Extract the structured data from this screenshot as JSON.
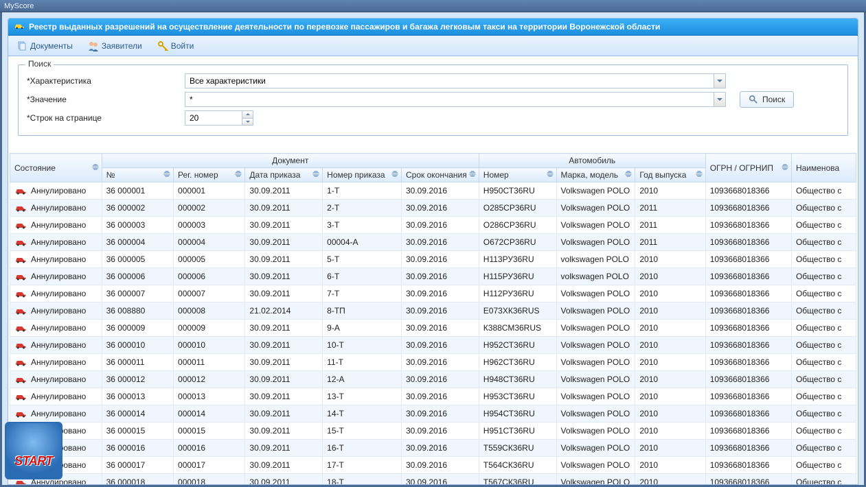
{
  "window": {
    "title": "MyScore"
  },
  "panel": {
    "title": "Реестр выданных разрешений на осуществление деятельности по перевозке пассажиров и багажа легковым такси на территории Воронежской области"
  },
  "toolbar": {
    "documents": "Документы",
    "applicants": "Заявители",
    "login": "Войти"
  },
  "search": {
    "legend": "Поиск",
    "char_label": "*Характеристика",
    "char_value": "Все характеристики",
    "val_label": "*Значение",
    "val_value": "*",
    "rows_label": "*Строк на странице",
    "rows_value": "20",
    "button": "Поиск"
  },
  "grid": {
    "group_doc": "Документ",
    "group_car": "Автомобиль",
    "headers": {
      "status": "Состояние",
      "num": "№",
      "regnum": "Рег. номер",
      "orddate": "Дата приказа",
      "ordnum": "Номер приказа",
      "expiry": "Срок окончания",
      "carnum": "Номер",
      "model": "Марка, модель",
      "year": "Год выпуска",
      "ogrn": "ОГРН / ОГРНИП",
      "company": "Наименова"
    },
    "status_label": "Аннулировано",
    "company_snip": "Общество с",
    "rows": [
      {
        "num": "36 000001",
        "regnum": "000001",
        "orddate": "30.09.2011",
        "ordnum": "1-Т",
        "expiry": "30.09.2016",
        "carnum": "Н950СТ36RU",
        "model": "Volkswagen POLO",
        "year": "2010",
        "ogrn": "1093668018366"
      },
      {
        "num": "36 000002",
        "regnum": "000002",
        "orddate": "30.09.2011",
        "ordnum": "2-Т",
        "expiry": "30.09.2016",
        "carnum": "О285СР36RU",
        "model": "Volkswagen POLO",
        "year": "2011",
        "ogrn": "1093668018366"
      },
      {
        "num": "36 000003",
        "regnum": "000003",
        "orddate": "30.09.2011",
        "ordnum": "3-Т",
        "expiry": "30.09.2016",
        "carnum": "О286СР36RU",
        "model": "Volkswagen POLO",
        "year": "2011",
        "ogrn": "1093668018366"
      },
      {
        "num": "36 000004",
        "regnum": "000004",
        "orddate": "30.09.2011",
        "ordnum": "00004-А",
        "expiry": "30.09.2016",
        "carnum": "О672СР36RU",
        "model": "Volkswagen POLO",
        "year": "2011",
        "ogrn": "1093668018366"
      },
      {
        "num": "36 000005",
        "regnum": "000005",
        "orddate": "30.09.2011",
        "ordnum": "5-Т",
        "expiry": "30.09.2016",
        "carnum": "Н113РУ36RU",
        "model": "volkswagen POLO",
        "year": "2010",
        "ogrn": "1093668018366"
      },
      {
        "num": "36 000006",
        "regnum": "000006",
        "orddate": "30.09.2011",
        "ordnum": "6-Т",
        "expiry": "30.09.2016",
        "carnum": "Н115РУ36RU",
        "model": "volkswagen POLO",
        "year": "2010",
        "ogrn": "1093668018366"
      },
      {
        "num": "36 000007",
        "regnum": "000007",
        "orddate": "30.09.2011",
        "ordnum": "7-Т",
        "expiry": "30.09.2016",
        "carnum": "Н112РУ36RU",
        "model": "Volkswagen POLO",
        "year": "2010",
        "ogrn": "1093668018366"
      },
      {
        "num": "36 008880",
        "regnum": "000008",
        "orddate": "21.02.2014",
        "ordnum": "8-ТП",
        "expiry": "30.09.2016",
        "carnum": "Е073ХК36RUS",
        "model": "Volkswagen POLO",
        "year": "2010",
        "ogrn": "1093668018366"
      },
      {
        "num": "36 000009",
        "regnum": "000009",
        "orddate": "30.09.2011",
        "ordnum": "9-А",
        "expiry": "30.09.2016",
        "carnum": "К388СМ36RUS",
        "model": "Volkswagen POLO",
        "year": "2010",
        "ogrn": "1093668018366"
      },
      {
        "num": "36 000010",
        "regnum": "000010",
        "orddate": "30.09.2011",
        "ordnum": "10-Т",
        "expiry": "30.09.2016",
        "carnum": "Н952СТ36RU",
        "model": "Volkswagen POLO",
        "year": "2010",
        "ogrn": "1093668018366"
      },
      {
        "num": "36 000011",
        "regnum": "000011",
        "orddate": "30.09.2011",
        "ordnum": "11-Т",
        "expiry": "30.09.2016",
        "carnum": "Н962СТ36RU",
        "model": "Volkswagen POLO",
        "year": "2010",
        "ogrn": "1093668018366"
      },
      {
        "num": "36 000012",
        "regnum": "000012",
        "orddate": "30.09.2011",
        "ordnum": "12-А",
        "expiry": "30.09.2016",
        "carnum": "Н948СТ36RU",
        "model": "Volkswagen POLO",
        "year": "2010",
        "ogrn": "1093668018366"
      },
      {
        "num": "36 000013",
        "regnum": "000013",
        "orddate": "30.09.2011",
        "ordnum": "13-Т",
        "expiry": "30.09.2016",
        "carnum": "Н953СТ36RU",
        "model": "Volkswagen POLO",
        "year": "2010",
        "ogrn": "1093668018366"
      },
      {
        "num": "36 000014",
        "regnum": "000014",
        "orddate": "30.09.2011",
        "ordnum": "14-Т",
        "expiry": "30.09.2016",
        "carnum": "Н954СТ36RU",
        "model": "Volkswagen POLO",
        "year": "2010",
        "ogrn": "1093668018366"
      },
      {
        "num": "36 000015",
        "regnum": "000015",
        "orddate": "30.09.2011",
        "ordnum": "15-Т",
        "expiry": "30.09.2016",
        "carnum": "Н951СТ36RU",
        "model": "Volkswagen POLO",
        "year": "2010",
        "ogrn": "1093668018366"
      },
      {
        "num": "36 000016",
        "regnum": "000016",
        "orddate": "30.09.2011",
        "ordnum": "16-Т",
        "expiry": "30.09.2016",
        "carnum": "Т559СК36RU",
        "model": "Volkswagen POLO",
        "year": "2010",
        "ogrn": "1093668018366"
      },
      {
        "num": "36 000017",
        "regnum": "000017",
        "orddate": "30.09.2011",
        "ordnum": "17-Т",
        "expiry": "30.09.2016",
        "carnum": "Т564СК36RU",
        "model": "Volkswagen POLO",
        "year": "2010",
        "ogrn": "1093668018366"
      },
      {
        "num": "36 000018",
        "regnum": "000018",
        "orddate": "30.09.2011",
        "ordnum": "18-Т",
        "expiry": "30.09.2016",
        "carnum": "Т567СК36RU",
        "model": "Volkswagen POLO",
        "year": "2010",
        "ogrn": "1093668018366"
      }
    ]
  },
  "start": {
    "label": "START"
  }
}
